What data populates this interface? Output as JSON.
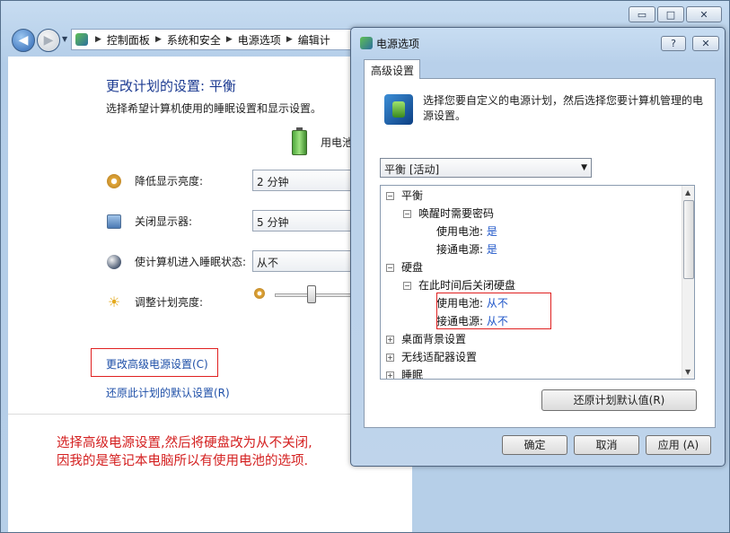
{
  "breadcrumb": [
    "控制面板",
    "系统和安全",
    "电源选项",
    "编辑计"
  ],
  "window_controls": {
    "minimize": "▭",
    "maximize": "□",
    "close": "✕"
  },
  "main": {
    "heading": "更改计划的设置: 平衡",
    "subheading": "选择希望计算机使用的睡眠设置和显示设置。",
    "battery_label": "用电池",
    "settings": [
      {
        "label": "降低显示亮度:",
        "value": "2 分钟"
      },
      {
        "label": "关闭显示器:",
        "value": "5 分钟"
      },
      {
        "label": "使计算机进入睡眠状态:",
        "value": "从不"
      },
      {
        "label": "调整计划亮度:",
        "value": ""
      }
    ],
    "brightness_level": 0.45,
    "advanced_link": "更改高级电源设置(C)",
    "restore_link": "还原此计划的默认设置(R)"
  },
  "note": {
    "line1": "选择高级电源设置,然后将硬盘改为从不关闭,",
    "line2": "因我的是笔记本电脑所以有使用电池的选项."
  },
  "dialog": {
    "title": "电源选项",
    "help": "?",
    "close": "✕",
    "tab": "高级设置",
    "description": "选择您要自定义的电源计划，然后选择您要计算机管理的电源设置。",
    "plan_selected": "平衡 [活动]",
    "tree": {
      "root": "平衡",
      "wake": "唤醒时需要密码",
      "wake_battery_label": "使用电池:",
      "wake_battery_value": "是",
      "wake_plugged_label": "接通电源:",
      "wake_plugged_value": "是",
      "disk": "硬盘",
      "disk_off": "在此时间后关闭硬盘",
      "disk_battery_label": "使用电池:",
      "disk_battery_value": "从不",
      "disk_plugged_label": "接通电源:",
      "disk_plugged_value": "从不",
      "desktop_bg": "桌面背景设置",
      "wireless": "无线适配器设置",
      "sleep": "睡眠"
    },
    "restore_defaults": "还原计划默认值(R)",
    "ok": "确定",
    "cancel": "取消",
    "apply": "应用 (A)"
  }
}
